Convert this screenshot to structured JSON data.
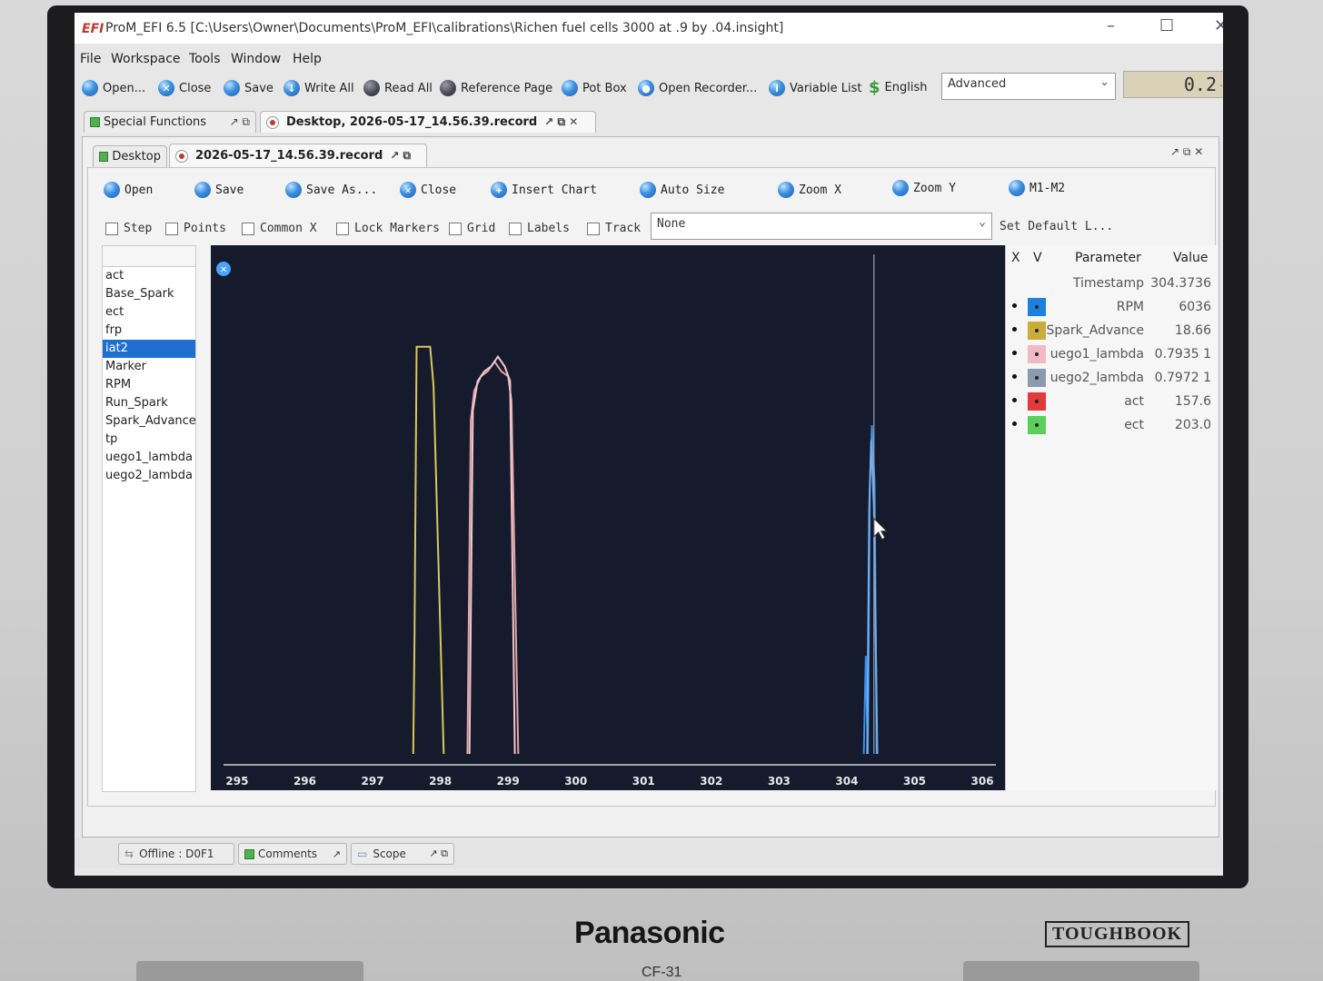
{
  "window": {
    "logo": "EFI",
    "title": "ProM_EFI 6.5 [C:\\Users\\Owner\\Documents\\ProM_EFI\\calibrations\\Richen fuel cells 3000 at .9 by .04.insight]",
    "minimize": "–",
    "maximize": "☐",
    "close": "✕"
  },
  "menu": [
    "File",
    "Workspace",
    "Tools",
    "Window",
    "Help"
  ],
  "toolbar": {
    "buttons": [
      "Open...",
      "Close",
      "Save",
      "Write All",
      "Read All",
      "Reference Page",
      "Pot Box",
      "Open Recorder...",
      "Variable List",
      "English"
    ],
    "mode_value": "Advanced",
    "readout_value": "0.2",
    "readout_more": "..."
  },
  "workspace_tabs": [
    {
      "label": "Special Functions"
    },
    {
      "label": "Desktop, 2026-05-17_14.56.39.record"
    }
  ],
  "inner_tabs": [
    {
      "label": "Desktop"
    },
    {
      "label": "2026-05-17_14.56.39.record"
    }
  ],
  "recorder_toolbar": [
    "Open",
    "Save",
    "Save As...",
    "Close",
    "Insert Chart",
    "Auto Size",
    "Zoom X",
    "Zoom Y",
    "M1-M2"
  ],
  "options": {
    "checkboxes": [
      "Step",
      "Points",
      "Common X",
      "Lock Markers",
      "Grid",
      "Labels",
      "Track"
    ],
    "track_value": "None",
    "set_default": "Set Default L..."
  },
  "signals": {
    "items": [
      "act",
      "Base_Spark",
      "ect",
      "frp",
      "iat2",
      "Marker",
      "RPM",
      "Run_Spark",
      "Spark_Advance",
      "tp",
      "uego1_lambda",
      "uego2_lambda"
    ],
    "selected": "iat2"
  },
  "params": {
    "headers": {
      "x": "X",
      "v": "V",
      "parameter": "Parameter",
      "value": "Value"
    },
    "timestamp_label": "Timestamp",
    "timestamp_value": "304.3736",
    "rows": [
      {
        "name": "RPM",
        "value": "6036",
        "color": "#1f7fe0"
      },
      {
        "name": "Spark_Advance",
        "value": "18.66",
        "color": "#c9ac3a"
      },
      {
        "name": "uego1_lambda",
        "value": "0.7935 1",
        "color": "#f0b9c6"
      },
      {
        "name": "uego2_lambda",
        "value": "0.7972 1",
        "color": "#8a9bb0"
      },
      {
        "name": "act",
        "value": "157.6",
        "color": "#e03a3a"
      },
      {
        "name": "ect",
        "value": "203.0",
        "color": "#5ad05a"
      }
    ]
  },
  "chart_data": {
    "type": "line",
    "xlim": [
      294.8,
      306.2
    ],
    "ylim": [
      0,
      1
    ],
    "x_ticks": [
      "295",
      "296",
      "297",
      "298",
      "299",
      "300",
      "301",
      "302",
      "303",
      "304",
      "305",
      "306"
    ],
    "cursor_x": 304.4,
    "series": [
      {
        "color": "#d8c95a",
        "x": [
          297.6,
          297.62,
          297.62,
          297.65,
          297.85,
          297.9,
          298.05
        ],
        "y": [
          0.0,
          0.25,
          0.26,
          0.83,
          0.83,
          0.75,
          0.0
        ]
      },
      {
        "color": "#e3a6a6",
        "x": [
          298.4,
          298.45,
          298.5,
          298.6,
          298.7,
          298.8,
          298.9,
          299.0,
          299.05,
          299.15
        ],
        "y": [
          0.0,
          0.68,
          0.74,
          0.77,
          0.78,
          0.8,
          0.78,
          0.77,
          0.72,
          0.0
        ]
      },
      {
        "color": "#f2c8cf",
        "x": [
          298.43,
          298.48,
          298.55,
          298.65,
          298.75,
          298.85,
          298.95,
          299.03,
          299.1
        ],
        "y": [
          0.0,
          0.7,
          0.76,
          0.78,
          0.79,
          0.81,
          0.79,
          0.76,
          0.0
        ]
      },
      {
        "color": "#3f8fe8",
        "x": [
          304.25,
          304.28,
          304.31,
          304.34,
          304.37,
          304.41,
          304.44
        ],
        "y": [
          0.0,
          0.2,
          0.0,
          0.55,
          0.67,
          0.55,
          0.0
        ]
      },
      {
        "color": "#6fb0f0",
        "x": [
          304.3,
          304.33,
          304.36,
          304.4,
          304.45
        ],
        "y": [
          0.0,
          0.5,
          0.64,
          0.5,
          0.0
        ]
      }
    ]
  },
  "status": {
    "offline": "Offline : D0F1",
    "comments": "Comments",
    "scope": "Scope"
  },
  "device": {
    "brand": "Panasonic",
    "line": "TOUGHBOOK",
    "model": "CF-31"
  }
}
